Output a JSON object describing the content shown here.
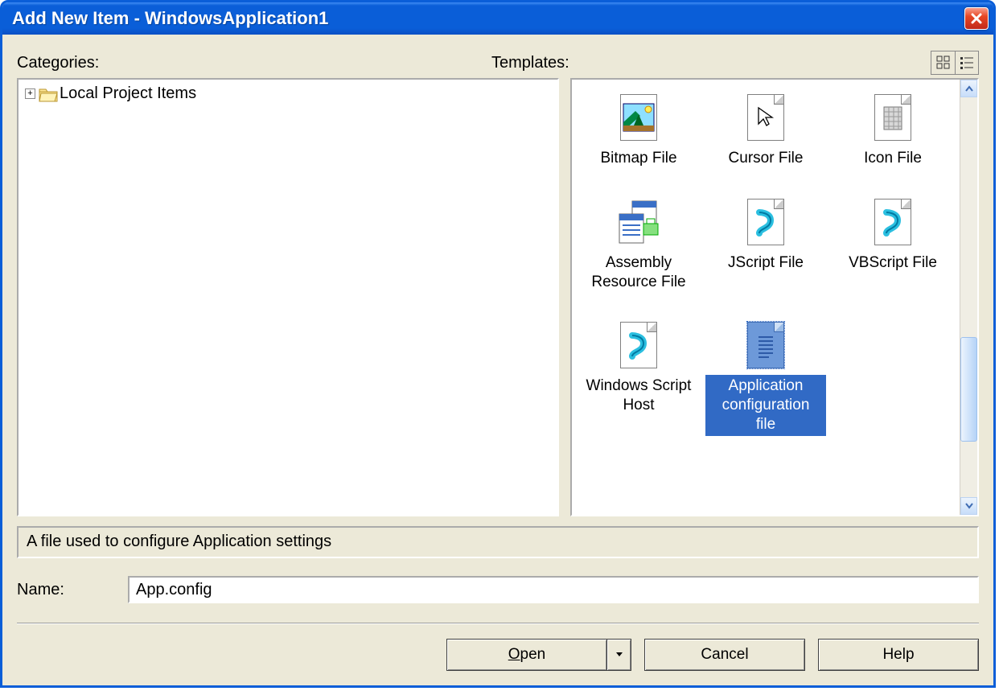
{
  "window": {
    "title": "Add New Item - WindowsApplication1"
  },
  "labels": {
    "categories": "Categories:",
    "templates": "Templates:",
    "name": "Name:"
  },
  "tree": {
    "root": "Local Project Items"
  },
  "templates": [
    {
      "label": "Bitmap File",
      "icon": "bitmap-icon",
      "selected": false
    },
    {
      "label": "Cursor File",
      "icon": "cursor-icon",
      "selected": false
    },
    {
      "label": "Icon File",
      "icon": "icon-file-icon",
      "selected": false
    },
    {
      "label": "Assembly Resource File",
      "icon": "assembly-resource-icon",
      "selected": false
    },
    {
      "label": "JScript File",
      "icon": "jscript-icon",
      "selected": false
    },
    {
      "label": "VBScript File",
      "icon": "vbscript-icon",
      "selected": false
    },
    {
      "label": "Windows Script Host",
      "icon": "wsh-icon",
      "selected": false
    },
    {
      "label": "Application configuration file",
      "icon": "appconfig-icon",
      "selected": true
    }
  ],
  "description": "A file used to configure Application settings",
  "name_value": "App.config",
  "buttons": {
    "open": "Open",
    "cancel": "Cancel",
    "help": "Help"
  }
}
